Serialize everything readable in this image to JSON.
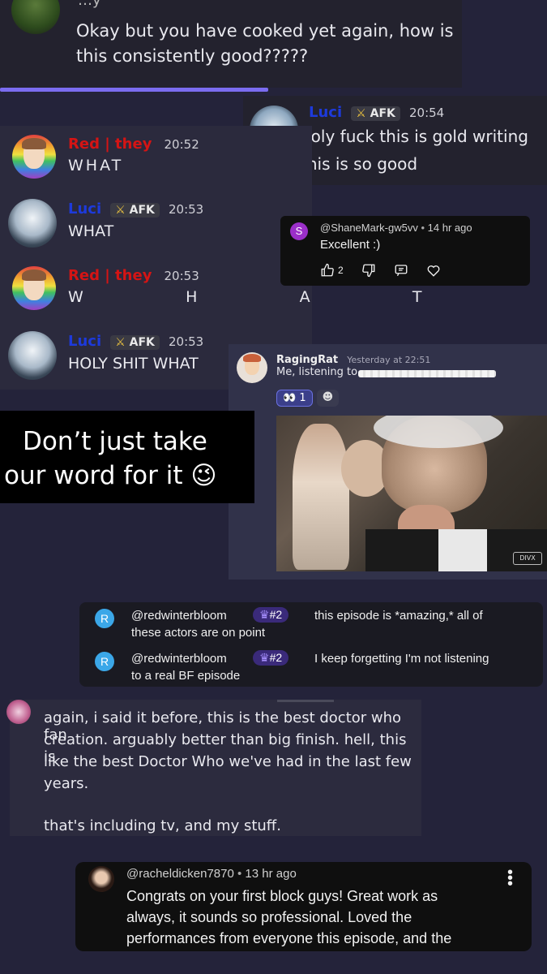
{
  "top_message": {
    "name_fragment": "…y",
    "text_line1": "Okay but you have cooked yet again, how is",
    "text_line2": "this consistently good?????"
  },
  "luci_top": {
    "name": "Luci",
    "badge": "AFK",
    "time": "20:54",
    "line1": "holy fuck this is gold writing",
    "line2": "this is so good"
  },
  "discord_chat": [
    {
      "name": "Red | they",
      "badge": "",
      "time": "20:52",
      "text": "WHAT",
      "style": "red"
    },
    {
      "name": "Luci",
      "badge": "AFK",
      "time": "20:53",
      "text": "WHAT",
      "style": "luci"
    },
    {
      "name": "Red | they",
      "badge": "",
      "time": "20:53",
      "text": "W       H       A       T",
      "style": "red"
    },
    {
      "name": "Luci",
      "badge": "AFK",
      "time": "20:53",
      "text": "HOLY SHIT WHAT",
      "style": "luci"
    }
  ],
  "yt_comment_1": {
    "avatar_letter": "S",
    "handle": "@ShaneMark-gw5vv",
    "age": "14 hr ago",
    "text": "Excellent :)",
    "likes": "2"
  },
  "raging_rat": {
    "name": "RagingRat",
    "timestamp": "Yesterday at 22:51",
    "text": "Me, listening to",
    "reaction_count": "1"
  },
  "tagline": {
    "line1": "Don’t just take",
    "line2": "our word for it 😉"
  },
  "redwinter": [
    {
      "letter": "R",
      "handle": "@redwinterbloom",
      "rank": "#2",
      "text1": "this episode is *amazing,* all of",
      "text2": "these actors are on point"
    },
    {
      "letter": "R",
      "handle": "@redwinterbloom",
      "rank": "#2",
      "text1": "I keep forgetting I'm not listening",
      "text2": "to a real BF episode"
    }
  ],
  "long_message": {
    "line1": "again, i said it before, this is the best doctor who fan",
    "line2": "creation. arguably better than big finish. hell, this is",
    "line3": "like the best Doctor Who we've had in the last few",
    "line4": "years.",
    "line5": "that's including tv, and my stuff."
  },
  "yt_comment_2": {
    "handle": "@racheldicken7870",
    "age": "13 hr ago",
    "line1": "Congrats on your first block guys! Great work as",
    "line2": "always, it sounds so professional. Loved the",
    "line3": "performances from everyone this episode, and the"
  },
  "colors": {
    "background": "#24233a",
    "red_name": "#d51414",
    "luci_name": "#1d3adb",
    "purple_accent": "#7b5cf0",
    "yt_avatar": "#9b2fc9"
  }
}
